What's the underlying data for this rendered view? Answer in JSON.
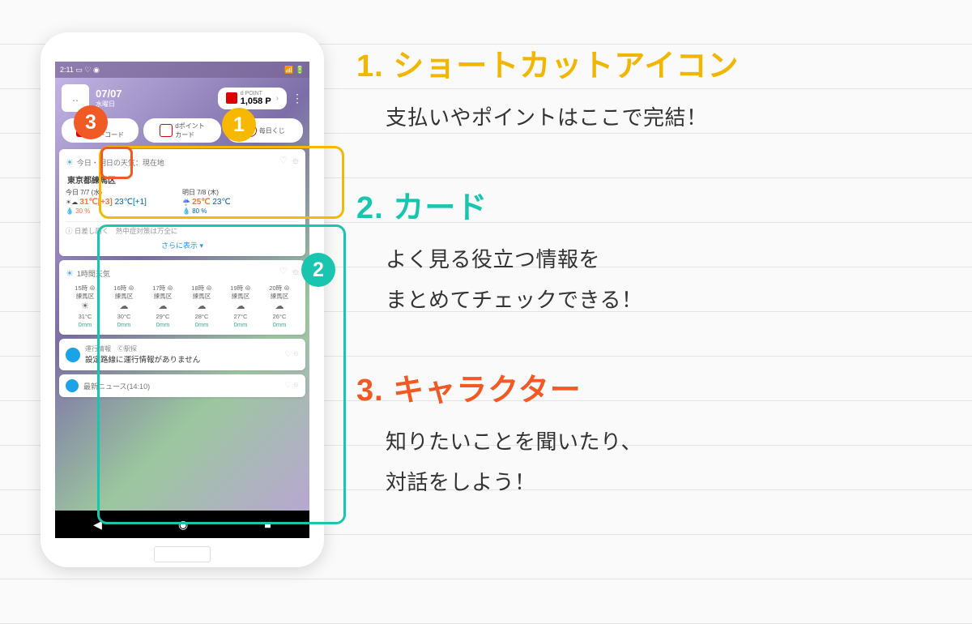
{
  "features": [
    {
      "num": "1.",
      "title": "ショートカットアイコン",
      "desc": "支払いやポイントはここで完結！",
      "color": "c-yellow"
    },
    {
      "num": "2.",
      "title": "カード",
      "desc": "よく見る役立つ情報を\nまとめてチェックできる！",
      "color": "c-teal"
    },
    {
      "num": "3.",
      "title": "キャラクター",
      "desc": "知りたいことを聞いたり、\n対話をしよう！",
      "color": "c-orange"
    }
  ],
  "badges": {
    "b1": "1",
    "b2": "2",
    "b3": "3"
  },
  "status": {
    "time": "2:11",
    "left_icons": "▭ ♡ ◉",
    "right_icons": "📶 🔋"
  },
  "date": {
    "main": "07/07",
    "sub": "水曜日"
  },
  "point": {
    "label": "d POINT",
    "value": "1,058 P"
  },
  "shortcuts": [
    {
      "label": "決済\nバーコード"
    },
    {
      "label": "dポイント\nカード"
    },
    {
      "label": "毎日くじ"
    }
  ],
  "weather": {
    "header": "今日・明日の天気：現在地",
    "location": "東京都練馬区",
    "today": {
      "label": "今日 7/7 (水)",
      "icon": "☀☁",
      "hi": "31℃[+3]",
      "lo": "23℃[+1]",
      "rain": "30 %"
    },
    "tomorrow": {
      "label": "明日 7/8 (木)",
      "icon": "☔",
      "hi": "25℃",
      "lo": "23℃",
      "rain": "80 %"
    },
    "advice": "ⓘ 日差し届く　熱中症対策は万全に",
    "more": "さらに表示 ▾"
  },
  "hourly": {
    "header": "1時間天気",
    "cols": [
      {
        "t": "15時",
        "a": "練馬区",
        "i": "☀",
        "temp": "31°C",
        "r": "0mm"
      },
      {
        "t": "16時",
        "a": "練馬区",
        "i": "☁",
        "temp": "30°C",
        "r": "0mm"
      },
      {
        "t": "17時",
        "a": "練馬区",
        "i": "☁",
        "temp": "29°C",
        "r": "0mm"
      },
      {
        "t": "18時",
        "a": "練馬区",
        "i": "☁",
        "temp": "28°C",
        "r": "0mm"
      },
      {
        "t": "19時",
        "a": "練馬区",
        "i": "☁",
        "temp": "27°C",
        "r": "0mm"
      },
      {
        "t": "20時",
        "a": "練馬区",
        "i": "☁",
        "temp": "26°C",
        "r": "0mm"
      }
    ]
  },
  "train": {
    "label": "運行情報　Ⓒ駅探",
    "msg": "設定路線に運行情報がありません"
  },
  "news": {
    "label": "最新ニュース(14:10)"
  }
}
